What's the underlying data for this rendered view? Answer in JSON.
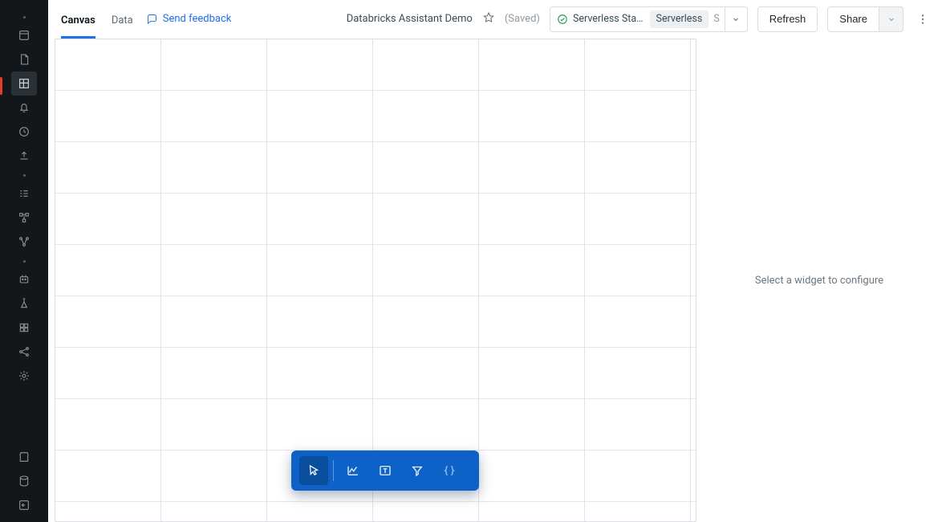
{
  "sidebar": {
    "items": [
      {
        "name": "home-icon"
      },
      {
        "name": "new-notebook-icon"
      },
      {
        "name": "dashboard-icon",
        "active": true
      },
      {
        "name": "alerts-icon"
      },
      {
        "name": "history-icon"
      },
      {
        "name": "upload-icon"
      },
      {
        "name": "tasks-icon"
      },
      {
        "name": "workflows-icon"
      },
      {
        "name": "pipelines-icon"
      },
      {
        "name": "assistant-icon"
      },
      {
        "name": "experiments-icon"
      },
      {
        "name": "models-icon"
      },
      {
        "name": "graph-icon"
      },
      {
        "name": "settings-icon"
      },
      {
        "name": "marketplace-icon"
      },
      {
        "name": "compute-icon"
      },
      {
        "name": "logout-icon"
      }
    ]
  },
  "header": {
    "tabs": [
      {
        "label": "Canvas",
        "active": true
      },
      {
        "label": "Data",
        "active": false
      }
    ],
    "feedback_label": "Send feedback",
    "doc_title": "Databricks Assistant Demo",
    "saved_label": "(Saved)",
    "cluster": {
      "status_label": "Serverless Sta…",
      "pill_label": "Serverless",
      "suffix": "S"
    },
    "refresh_label": "Refresh",
    "share_label": "Share"
  },
  "toolbox": {
    "tools": [
      {
        "name": "pointer-tool",
        "active": true
      },
      {
        "name": "chart-tool"
      },
      {
        "name": "text-tool"
      },
      {
        "name": "filter-tool"
      },
      {
        "name": "code-tool",
        "dim": true
      }
    ]
  },
  "config_panel": {
    "empty_message": "Select a widget to configure"
  }
}
